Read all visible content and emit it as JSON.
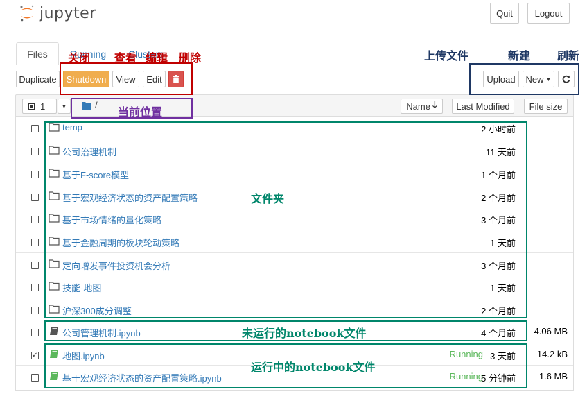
{
  "app": {
    "name": "jupyter"
  },
  "header": {
    "quit_label": "Quit",
    "logout_label": "Logout"
  },
  "tabs": {
    "files": "Files",
    "running": "Running",
    "clusters": "Clusters"
  },
  "toolbar": {
    "duplicate": "Duplicate",
    "shutdown": "Shutdown",
    "view": "View",
    "edit": "Edit",
    "upload": "Upload",
    "new": "New"
  },
  "list_header": {
    "select_count": "1",
    "path": "/",
    "name_sort": "Name",
    "last_modified": "Last Modified",
    "file_size": "File size"
  },
  "rows": [
    {
      "type": "folder",
      "name": "temp",
      "modified": "2 小时前",
      "size": "",
      "running": "",
      "checked": false
    },
    {
      "type": "folder",
      "name": "公司治理机制",
      "modified": "11 天前",
      "size": "",
      "running": "",
      "checked": false
    },
    {
      "type": "folder",
      "name": "基于F-score模型",
      "modified": "1 个月前",
      "size": "",
      "running": "",
      "checked": false
    },
    {
      "type": "folder",
      "name": "基于宏观经济状态的资产配置策略",
      "modified": "2 个月前",
      "size": "",
      "running": "",
      "checked": false
    },
    {
      "type": "folder",
      "name": "基于市场情绪的量化策略",
      "modified": "3 个月前",
      "size": "",
      "running": "",
      "checked": false
    },
    {
      "type": "folder",
      "name": "基于金融周期的板块轮动策略",
      "modified": "1 天前",
      "size": "",
      "running": "",
      "checked": false
    },
    {
      "type": "folder",
      "name": "定向增发事件投资机会分析",
      "modified": "3 个月前",
      "size": "",
      "running": "",
      "checked": false
    },
    {
      "type": "folder",
      "name": "技能-地图",
      "modified": "1 天前",
      "size": "",
      "running": "",
      "checked": false
    },
    {
      "type": "folder",
      "name": "沪深300成分调整",
      "modified": "2 个月前",
      "size": "",
      "running": "",
      "checked": false
    },
    {
      "type": "notebook-stopped",
      "name": "公司管理机制.ipynb",
      "modified": "4 个月前",
      "size": "4.06 MB",
      "running": "",
      "checked": false
    },
    {
      "type": "notebook-running",
      "name": "地图.ipynb",
      "modified": "3 天前",
      "size": "14.2 kB",
      "running": "Running",
      "checked": true
    },
    {
      "type": "notebook-running",
      "name": "基于宏观经济状态的资产配置策略.ipynb",
      "modified": "5 分钟前",
      "size": "1.6 MB",
      "running": "Running",
      "checked": false
    }
  ],
  "annotations": {
    "shutdown": "关闭",
    "view": "查看",
    "edit": "编辑",
    "delete": "删除",
    "upload": "上传文件",
    "new": "新建",
    "refresh": "刷新",
    "current_location": "当前位置",
    "folders": "文件夹",
    "stopped_notebook": "未运行的notebook文件",
    "running_notebook": "运行中的notebook文件"
  },
  "colors": {
    "link": "#337ab7",
    "running": "#5cb85c",
    "logo_orange": "#f37726",
    "anno_red": "#c00000",
    "anno_blue": "#1f3864",
    "anno_purple": "#7030a0",
    "anno_green": "#00866b"
  }
}
